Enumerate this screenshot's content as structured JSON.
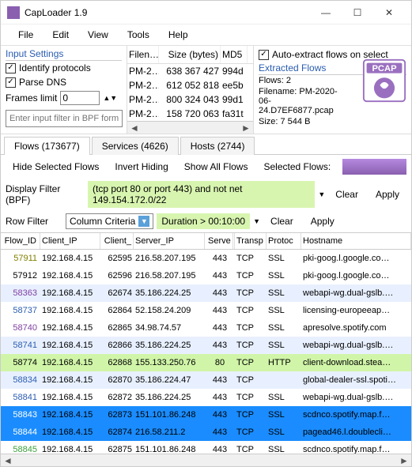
{
  "title": "CapLoader 1.9",
  "menu": [
    "File",
    "Edit",
    "View",
    "Tools",
    "Help"
  ],
  "inputSettings": {
    "hdr": "Input Settings",
    "identify": "Identify protocols",
    "parse": "Parse DNS",
    "framesLimitLbl": "Frames limit",
    "framesLimitVal": "0",
    "bpfPlaceholder": "Enter input filter in BPF format"
  },
  "fileCols": {
    "fn": "Filen…",
    "sz": "Size (bytes)",
    "md5": "MD5"
  },
  "files": [
    {
      "fn": "PM-2…",
      "sz": "638 367 427",
      "md5": "994d"
    },
    {
      "fn": "PM-2…",
      "sz": "612 052 818",
      "md5": "ee5b"
    },
    {
      "fn": "PM-2…",
      "sz": "800 324 043",
      "md5": "99d1"
    },
    {
      "fn": "PM-2…",
      "sz": "158 720 063",
      "md5": "fa31t"
    }
  ],
  "extracted": {
    "auto": "Auto-extract flows on select",
    "hdr": "Extracted Flows",
    "flows": "Flows: 2",
    "fn": "Filename: PM-2020-06-24.D7EF6877.pcap",
    "size": "Size: 7 544 B",
    "badge": "PCAP"
  },
  "tabs": [
    "Flows (173677)",
    "Services (4626)",
    "Hosts (2744)"
  ],
  "tb": {
    "hide": "Hide Selected Flows",
    "invert": "Invert Hiding",
    "show": "Show All Flows",
    "sel": "Selected Flows:"
  },
  "bpf": {
    "lbl": "Display Filter (BPF)",
    "val": "(tcp port 80 or port 443) and not net 149.154.172.0/22",
    "clear": "Clear",
    "apply": "Apply"
  },
  "rowf": {
    "lbl": "Row Filter",
    "combo": "Column Criteria",
    "dur": "Duration > 00:10:00",
    "clear": "Clear",
    "apply": "Apply"
  },
  "cols": {
    "flow": "Flow_ID",
    "cip": "Client_IP",
    "cport": "Client_",
    "sip": "Server_IP",
    "sport": "Serve",
    "tr": "Transp",
    "pr": "Protoc",
    "host": "Hostname"
  },
  "rows": [
    {
      "id": "57911",
      "cip": "192.168.4.15",
      "cp": "62595",
      "sip": "216.58.207.195",
      "sp": "443",
      "tr": "TCP",
      "pr": "SSL",
      "h": "pki-goog.l.google.co…",
      "bg": "#fff",
      "fg": "#7f7f00"
    },
    {
      "id": "57912",
      "cip": "192.168.4.15",
      "cp": "62596",
      "sip": "216.58.207.195",
      "sp": "443",
      "tr": "TCP",
      "pr": "SSL",
      "h": "pki-goog.l.google.co…",
      "bg": "#fff",
      "fg": "#000"
    },
    {
      "id": "58363",
      "cip": "192.168.4.15",
      "cp": "62674",
      "sip": "35.186.224.25",
      "sp": "443",
      "tr": "TCP",
      "pr": "SSL",
      "h": "webapi-wg.dual-gslb.…",
      "bg": "#e8f0ff",
      "fg": "#7f3fa0"
    },
    {
      "id": "58737",
      "cip": "192.168.4.15",
      "cp": "62864",
      "sip": "52.158.24.209",
      "sp": "443",
      "tr": "TCP",
      "pr": "SSL",
      "h": "licensing-europeeap…",
      "bg": "#fff",
      "fg": "#2a5db0"
    },
    {
      "id": "58740",
      "cip": "192.168.4.15",
      "cp": "62865",
      "sip": "34.98.74.57",
      "sp": "443",
      "tr": "TCP",
      "pr": "SSL",
      "h": "apresolve.spotify.com",
      "bg": "#fff",
      "fg": "#7f3fa0"
    },
    {
      "id": "58741",
      "cip": "192.168.4.15",
      "cp": "62866",
      "sip": "35.186.224.25",
      "sp": "443",
      "tr": "TCP",
      "pr": "SSL",
      "h": "webapi-wg.dual-gslb.…",
      "bg": "#e8f0ff",
      "fg": "#2a5db0"
    },
    {
      "id": "58774",
      "cip": "192.168.4.15",
      "cp": "62868",
      "sip": "155.133.250.76",
      "sp": "80",
      "tr": "TCP",
      "pr": "HTTP",
      "h": "client-download.stea…",
      "bg": "#d0f5a8",
      "fg": "#000"
    },
    {
      "id": "58834",
      "cip": "192.168.4.15",
      "cp": "62870",
      "sip": "35.186.224.47",
      "sp": "443",
      "tr": "TCP",
      "pr": "",
      "h": "global-dealer-ssl.spoti…",
      "bg": "#e8f0ff",
      "fg": "#2a5db0"
    },
    {
      "id": "58841",
      "cip": "192.168.4.15",
      "cp": "62872",
      "sip": "35.186.224.25",
      "sp": "443",
      "tr": "TCP",
      "pr": "SSL",
      "h": "webapi-wg.dual-gslb.…",
      "bg": "#fff",
      "fg": "#2a5db0"
    },
    {
      "id": "58843",
      "cip": "192.168.4.15",
      "cp": "62873",
      "sip": "151.101.86.248",
      "sp": "443",
      "tr": "TCP",
      "pr": "SSL",
      "h": "scdnco.spotify.map.f…",
      "bg": "#1a8cff",
      "fg": "#fff"
    },
    {
      "id": "58844",
      "cip": "192.168.4.15",
      "cp": "62874",
      "sip": "216.58.211.2",
      "sp": "443",
      "tr": "TCP",
      "pr": "SSL",
      "h": "pagead46.l.doublecli…",
      "bg": "#1a8cff",
      "fg": "#fff"
    },
    {
      "id": "58845",
      "cip": "192.168.4.15",
      "cp": "62875",
      "sip": "151.101.86.248",
      "sp": "443",
      "tr": "TCP",
      "pr": "SSL",
      "h": "scdnco.spotify.map.f…",
      "bg": "#fff",
      "fg": "#3aa03a"
    }
  ]
}
